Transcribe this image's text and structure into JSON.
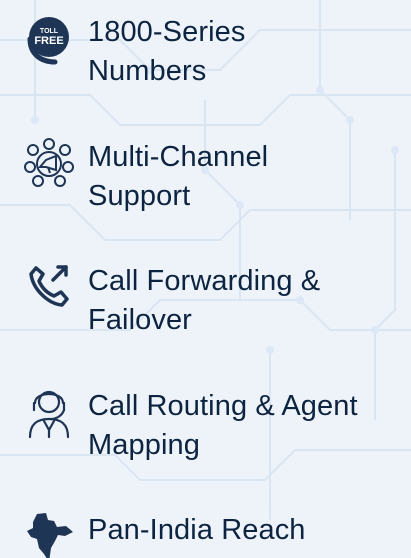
{
  "features": {
    "items": [
      {
        "label": "1800-Series\nNumbers",
        "icon": "toll-free-icon",
        "badge_top": "TOLL",
        "badge_bottom": "FREE"
      },
      {
        "label": "Multi-Channel\nSupport",
        "icon": "multi-channel-icon"
      },
      {
        "label": "Call Forwarding &\nFailover",
        "icon": "call-forwarding-icon"
      },
      {
        "label": "Call Routing & Agent\nMapping",
        "icon": "agent-headset-icon"
      },
      {
        "label": "Pan-India Reach",
        "icon": "india-map-icon"
      }
    ]
  },
  "colors": {
    "text": "#0d2441",
    "icon": "#1f3555",
    "background": "#eef3f9"
  }
}
